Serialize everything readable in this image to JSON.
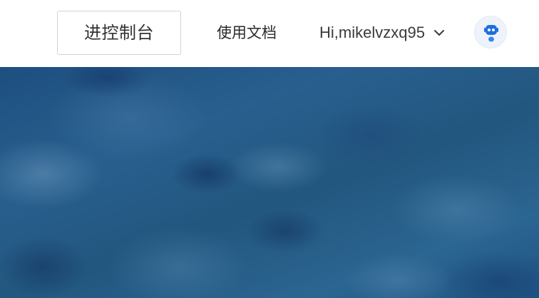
{
  "header": {
    "console_button_label": "进控制台",
    "docs_link_label": "使用文档",
    "user_greeting": "Hi,mikelvzxq95",
    "user_menu_icon": "chevron-down-icon",
    "avatar_icon": "robot-avatar-icon"
  },
  "hero": {
    "background": "blue textured water/sky pattern"
  },
  "colors": {
    "hero_blue": "#245a88",
    "avatar_accent": "#1e6fe0",
    "text_primary": "#333333"
  }
}
